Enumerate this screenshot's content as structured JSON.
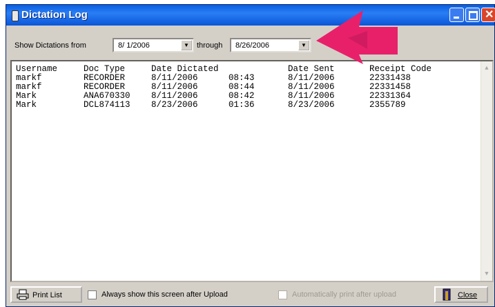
{
  "window": {
    "title": "Dictation Log"
  },
  "filter": {
    "from_label": "Show Dictations from",
    "from_value": "8/ 1/2006",
    "through_label": "through",
    "through_value": "8/26/2006"
  },
  "list": {
    "headers": [
      "Username",
      "Doc Type",
      "Date Dictated",
      "Date Sent",
      "Receipt Code"
    ],
    "rows": [
      {
        "user": "markf",
        "doc": "RECORDER",
        "date": "8/11/2006",
        "time": "08:43",
        "sent": "8/11/2006",
        "code": "22331438"
      },
      {
        "user": "markf",
        "doc": "RECORDER",
        "date": "8/11/2006",
        "time": "08:44",
        "sent": "8/11/2006",
        "code": "22331458"
      },
      {
        "user": "Mark",
        "doc": "ANA670330",
        "date": "8/11/2006",
        "time": "08:42",
        "sent": "8/11/2006",
        "code": "22331364"
      },
      {
        "user": "Mark",
        "doc": "DCL874113",
        "date": "8/23/2006",
        "time": "01:36",
        "sent": "8/23/2006",
        "code": "2355789"
      }
    ]
  },
  "footer": {
    "print_label": "Print List",
    "always_show_label": "Always show this screen after Upload",
    "auto_print_label": "Automatically print after upload",
    "close_label": "Close"
  },
  "colors": {
    "annotation_arrow": "#e8206a"
  }
}
